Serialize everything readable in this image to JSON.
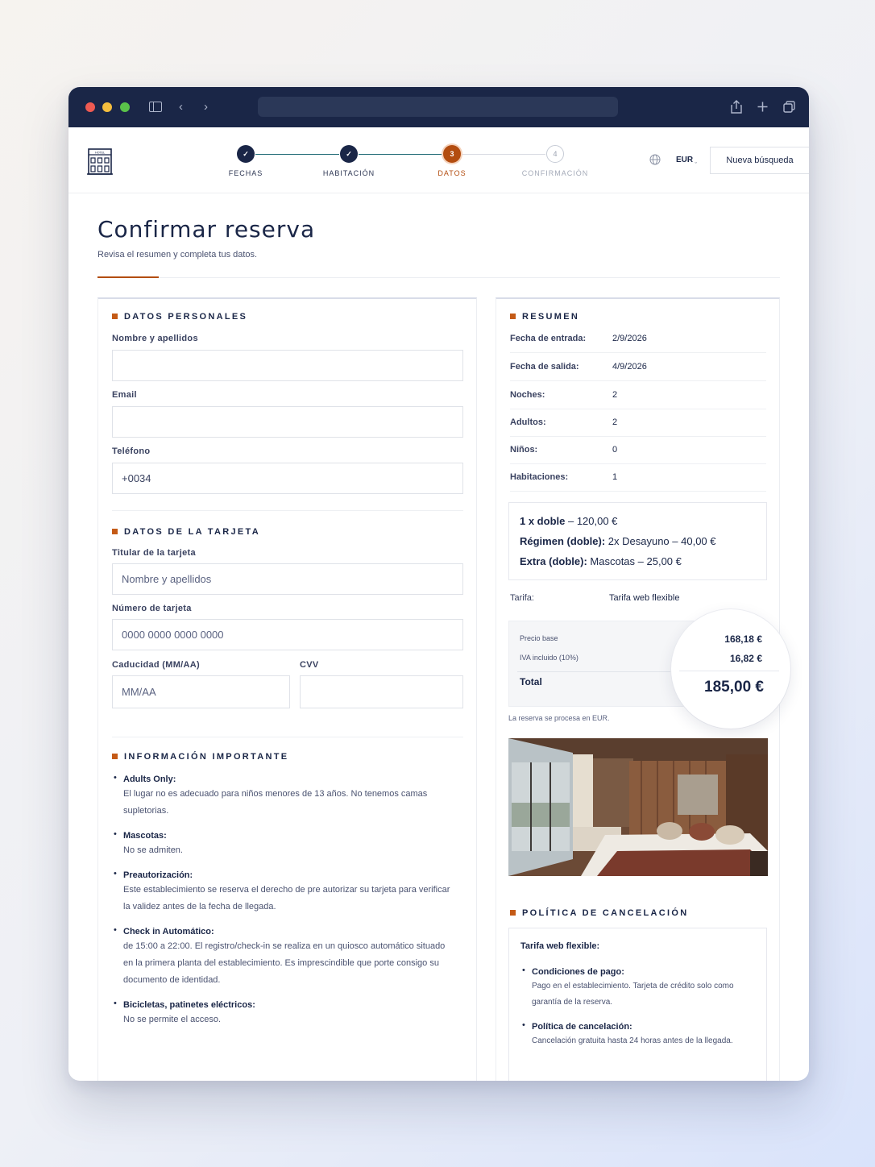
{
  "steps": [
    {
      "label": "FECHAS",
      "state": "done",
      "marker": "✓"
    },
    {
      "label": "HABITACIÓN",
      "state": "done",
      "marker": "✓"
    },
    {
      "label": "DATOS",
      "state": "active",
      "marker": "3"
    },
    {
      "label": "CONFIRMACIÓN",
      "state": "todo",
      "marker": "4"
    }
  ],
  "header": {
    "currency": "EUR",
    "new_search": "Nueva búsqueda",
    "logo_icon": "hotel-building-icon",
    "logo_text": "HOTEL"
  },
  "page": {
    "title": "Confirmar reserva",
    "subtitle": "Revisa el resumen y completa tus datos."
  },
  "personal": {
    "title": "DATOS PERSONALES",
    "name_label": "Nombre y apellidos",
    "email_label": "Email",
    "phone_label": "Teléfono",
    "phone_value": "+0034"
  },
  "card": {
    "title": "DATOS DE LA TARJETA",
    "holder_label": "Titular de la tarjeta",
    "holder_placeholder": "Nombre y apellidos",
    "number_label": "Número de tarjeta",
    "number_placeholder": "0000 0000 0000 0000",
    "expiry_label": "Caducidad (MM/AA)",
    "expiry_placeholder": "MM/AA",
    "cvv_label": "CVV"
  },
  "info": {
    "title": "INFORMACIÓN IMPORTANTE",
    "items": [
      {
        "title": "Adults Only:",
        "text": "El lugar no es adecuado para niños menores de 13 años. No tenemos camas supletorias."
      },
      {
        "title": "Mascotas:",
        "text": "No se admiten."
      },
      {
        "title": "Preautorización:",
        "text": "Este establecimiento se reserva el derecho de pre autorizar su tarjeta para verificar la validez antes de la fecha de llegada."
      },
      {
        "title": "Check in Automático:",
        "text": "de 15:00 a 22:00. El registro/check-in se realiza en un quiosco automático situado en la primera planta del establecimiento. Es imprescindible que porte consigo  su  documento de identidad."
      },
      {
        "title": "Bicicletas, patinetes eléctricos:",
        "text": "No se permite el acceso."
      }
    ]
  },
  "summary": {
    "title": "RESUMEN",
    "rows": [
      {
        "label": "Fecha de entrada:",
        "value": "2/9/2026"
      },
      {
        "label": "Fecha de salida:",
        "value": "4/9/2026"
      },
      {
        "label": "Noches:",
        "value": "2"
      },
      {
        "label": "Adultos:",
        "value": "2"
      },
      {
        "label": "Niños:",
        "value": "0"
      },
      {
        "label": "Habitaciones:",
        "value": "1"
      }
    ],
    "room_line": {
      "bold": "1 x doble",
      "rest": " – 120,00 €"
    },
    "regimen_line": {
      "bold": "Régimen (doble):",
      "rest": " 2x Desayuno – 40,00 €"
    },
    "extra_line": {
      "bold": "Extra (doble):",
      "rest": " Mascotas – 25,00 €"
    },
    "tarifa_label": "Tarifa:",
    "tarifa_value": "Tarifa web flexible",
    "base_label": "Precio base",
    "base_value": "168,18 €",
    "vat_label": "IVA incluido (10%)",
    "vat_value": "16,82 €",
    "total_label": "Total",
    "total_value": "185,00 €",
    "note": "La reserva se procesa en EUR."
  },
  "policy": {
    "title": "POLÍTICA DE CANCELACIÓN",
    "rate": "Tarifa web flexible:",
    "items": [
      {
        "title": "Condiciones de pago:",
        "text": "Pago en el establecimiento. Tarjeta de crédito solo como garantía de la reserva."
      },
      {
        "title": "Política de cancelación:",
        "text": "Cancelación gratuita hasta 24 horas antes de la llegada."
      }
    ]
  },
  "colors": {
    "navy": "#1a2647",
    "accent": "#b34d10"
  }
}
